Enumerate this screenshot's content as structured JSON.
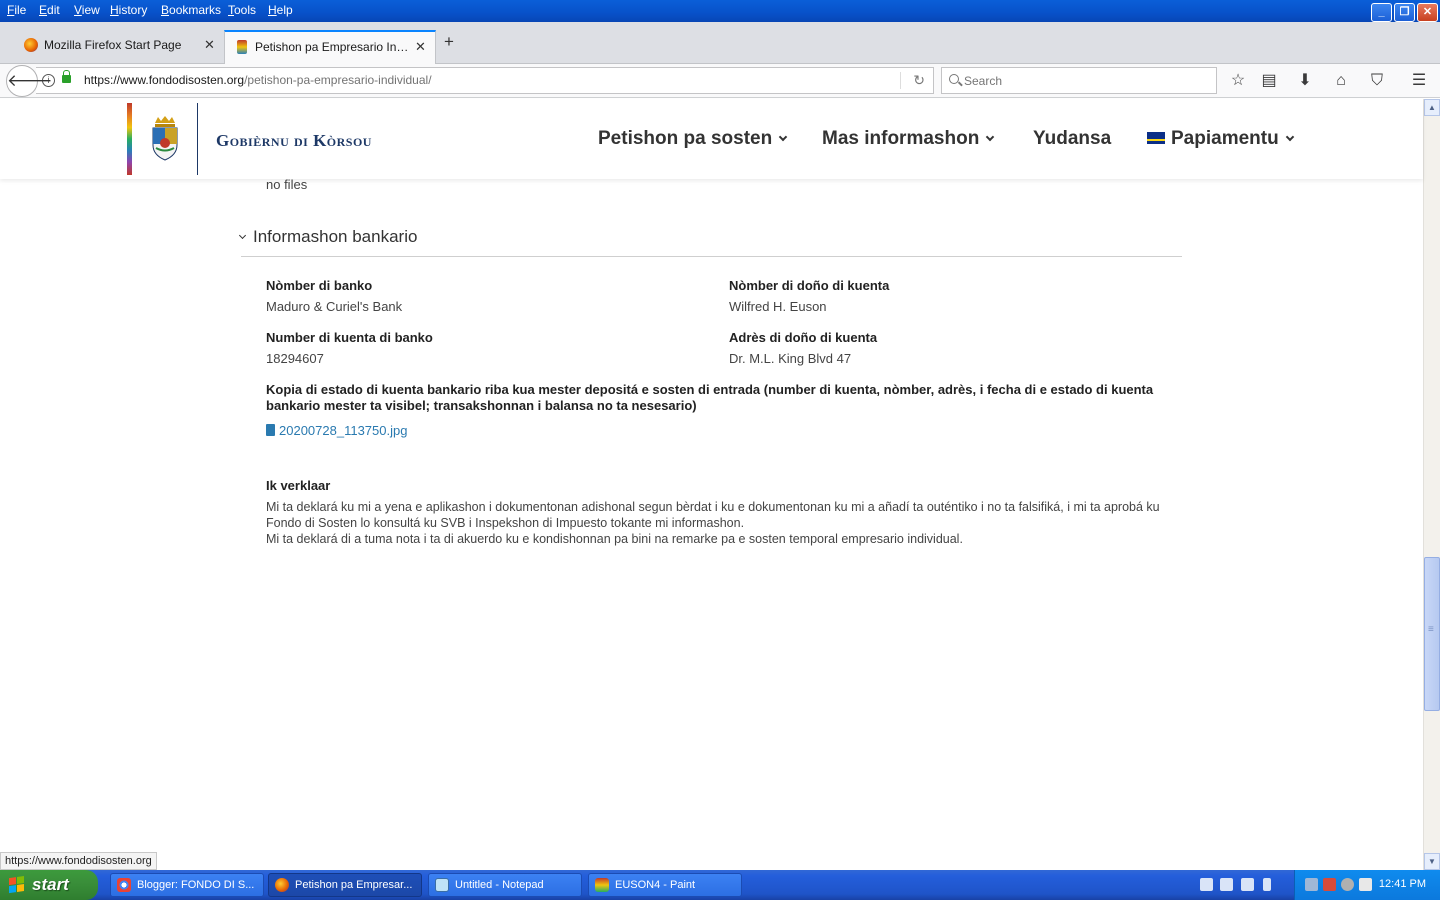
{
  "menubar": {
    "items": [
      "File",
      "Edit",
      "View",
      "History",
      "Bookmarks",
      "Tools",
      "Help"
    ]
  },
  "tabs": [
    {
      "label": "Mozilla Firefox Start Page",
      "active": false
    },
    {
      "label": "Petishon pa Empresario Indivi...",
      "active": true
    }
  ],
  "navbar": {
    "url_host": "https://www.fondodisosten.org",
    "url_path": "/petishon-pa-empresario-individual/",
    "search_placeholder": "Search"
  },
  "site": {
    "logo_text": "Gobièrnu di Kòrsou",
    "nav": [
      {
        "label": "Petishon pa sosten",
        "dropdown": true
      },
      {
        "label": "Mas informashon",
        "dropdown": true
      },
      {
        "label": "Yudansa",
        "dropdown": false
      },
      {
        "label": "Papiamentu",
        "dropdown": true,
        "flag": "curacao-flag"
      }
    ]
  },
  "content": {
    "no_files": "no files",
    "section_title": "Informashon bankario",
    "fields": [
      {
        "label": "Nòmber di banko",
        "value": "Maduro & Curiel's Bank"
      },
      {
        "label": "Nòmber di doño di kuenta",
        "value": "Wilfred H. Euson"
      },
      {
        "label": "Number di kuenta di banko",
        "value": "18294607"
      },
      {
        "label": "Adrès di doño di kuenta",
        "value": "Dr. M.L. King Blvd 47"
      }
    ],
    "copy_label": "Kopia di estado di kuenta bankario riba kua mester depositá e sosten di entrada (number di kuenta, nòmber, adrès, i fecha di e estado di kuenta bankario mester ta visibel; transakshonnan i balansa no ta nesesario)",
    "file_name": "20200728_113750.jpg",
    "declare_title": "Ik verklaar",
    "declare_line1": "Mi ta deklará ku mi a yena e aplikashon i dokumentonan adishonal segun bèrdat i ku e dokumentonan ku mi a añadí ta outéntiko i no ta falsifiká, i mi ta aprobá ku Fondo di Sosten lo konsultá ku SVB i Inspekshon di Impuesto tokante mi informashon.",
    "declare_line2": "Mi ta deklará di a tuma nota i ta di akuerdo ku e kondishonnan pa bini na remarke pa e sosten temporal empresario individual."
  },
  "status_text": "https://www.fondodisosten.org",
  "taskbar": {
    "start_label": "start",
    "tasks": [
      {
        "label": "Blogger: FONDO DI S...",
        "icon": "chrome-icon",
        "active": false
      },
      {
        "label": "Petishon pa Empresar...",
        "icon": "firefox-icon",
        "active": true
      },
      {
        "label": "Untitled - Notepad",
        "icon": "notepad-icon",
        "active": false
      },
      {
        "label": "EUSON4 - Paint",
        "icon": "paint-icon",
        "active": false
      }
    ],
    "clock": "12:41 PM"
  }
}
